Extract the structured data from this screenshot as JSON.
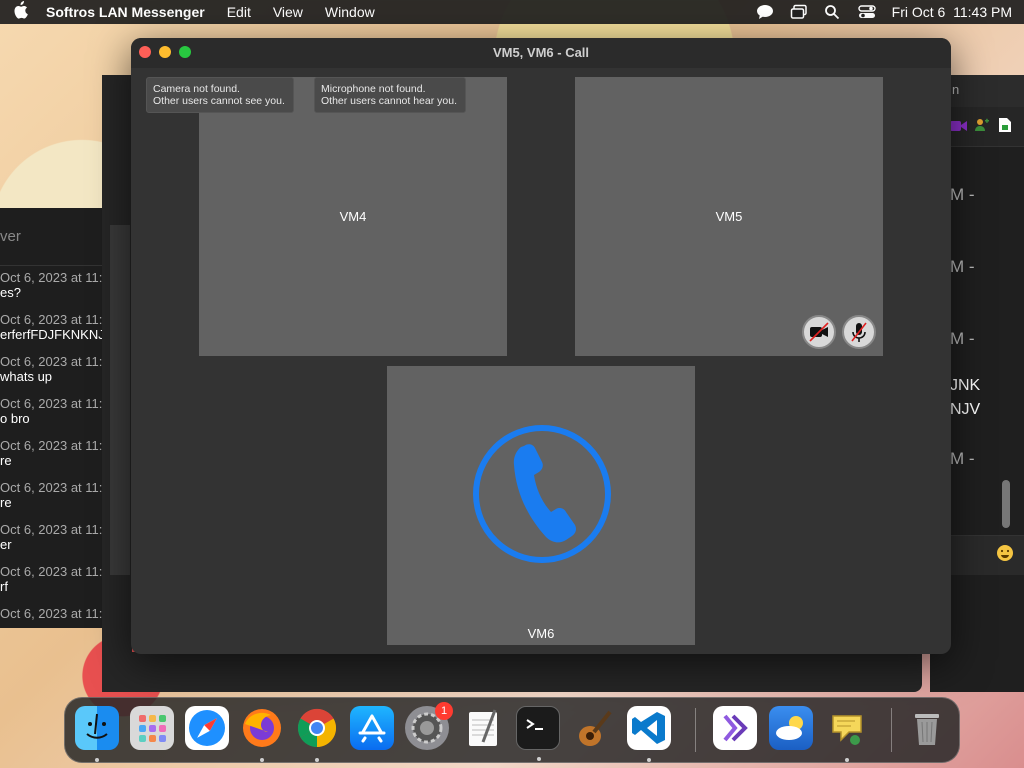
{
  "menubar": {
    "app_name": "Softros LAN Messenger",
    "menus": [
      "Edit",
      "View",
      "Window"
    ],
    "datetime": "Fri Oct 6  11:43 PM"
  },
  "call_window": {
    "title": "VM5, VM6 - Call",
    "tooltips": {
      "camera": "Camera not found.\nOther users cannot see you.",
      "microphone": "Microphone not found.\nOther users cannot hear you."
    },
    "participants": [
      {
        "name": "VM4"
      },
      {
        "name": "VM5"
      },
      {
        "name": "VM6"
      }
    ],
    "call_icon_color": "#1a7cf0"
  },
  "bg_chat": {
    "header": "ver",
    "messages": [
      {
        "ts": "Oct 6, 2023 at 11:",
        "text": "es?"
      },
      {
        "ts": "Oct 6, 2023 at 11:",
        "text": "erferfFDJFKNKNJ"
      },
      {
        "ts": "Oct 6, 2023 at 11:",
        "text": "whats up"
      },
      {
        "ts": "Oct 6, 2023 at 11:",
        "text": "o bro"
      },
      {
        "ts": "Oct 6, 2023 at 11:",
        "text": "re"
      },
      {
        "ts": "Oct 6, 2023 at 11:",
        "text": "re"
      },
      {
        "ts": "Oct 6, 2023 at 11:",
        "text": "er"
      },
      {
        "ts": "Oct 6, 2023 at 11:",
        "text": "rf"
      },
      {
        "ts": "Oct 6, 2023 at 11:",
        "text": ""
      }
    ]
  },
  "bg_right": {
    "title_fragment": "n",
    "lines": [
      "M -",
      "M -",
      "M -",
      "JNK",
      "NJV",
      "M -"
    ]
  },
  "dock": {
    "items": [
      "Finder",
      "Launchpad",
      "Safari",
      "Firefox",
      "Chrome",
      "App Store",
      "System Settings",
      "TextEdit",
      "Terminal",
      "GarageBand",
      "Visual Studio Code",
      "Visual Studio",
      "Weather",
      "Softros LAN Messenger",
      "Trash"
    ],
    "settings_badge": "1"
  }
}
